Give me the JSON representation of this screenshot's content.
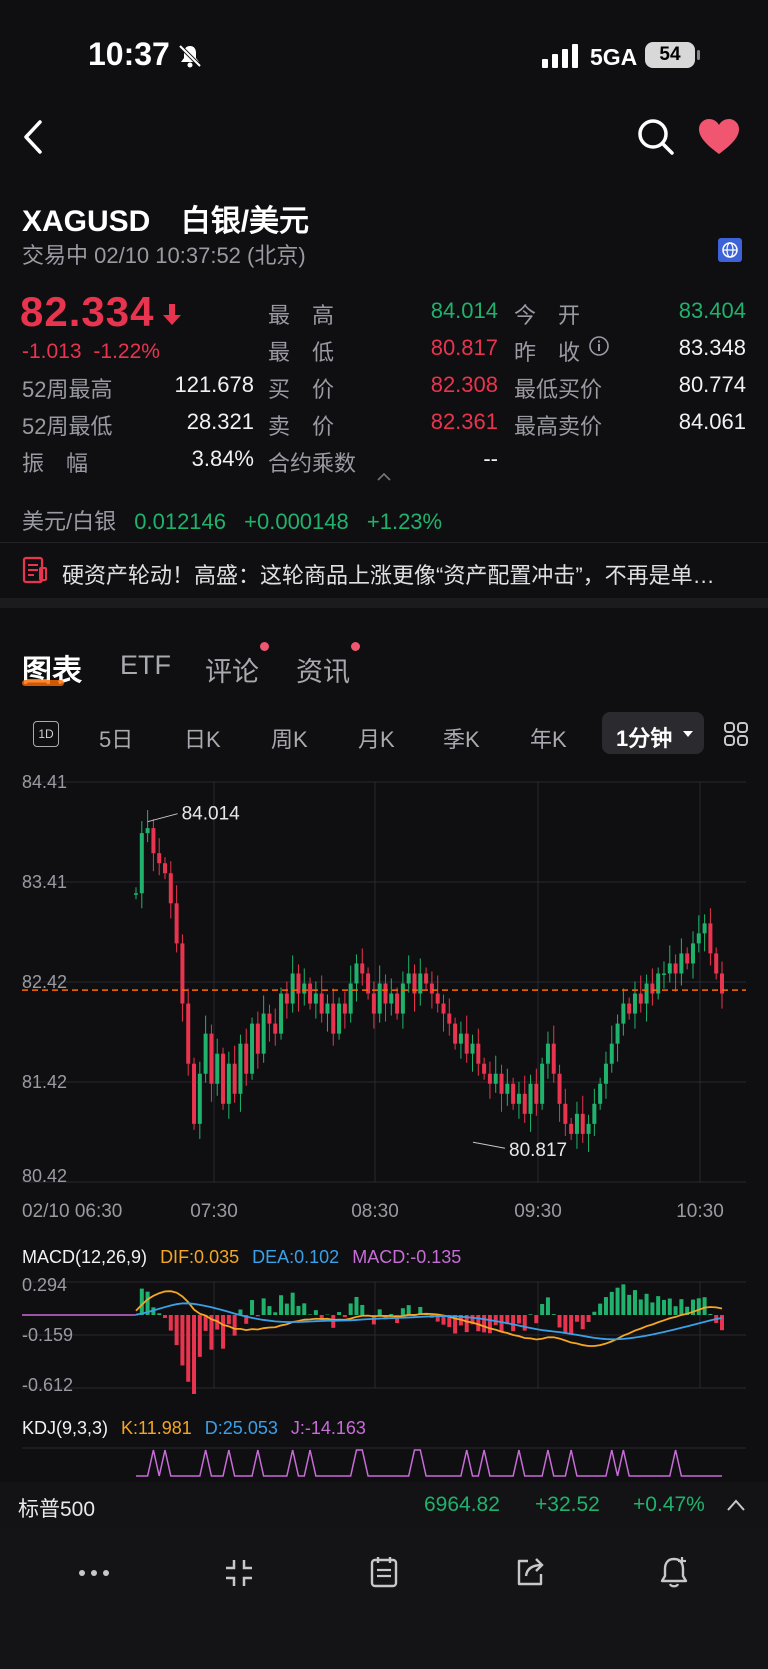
{
  "status_bar": {
    "time": "10:37",
    "network": "5GA",
    "battery": "54"
  },
  "header": {
    "symbol": "XAGUSD",
    "name": "白银/美元",
    "status_line": "交易中 02/10 10:37:52 (北京)"
  },
  "quote": {
    "price": "82.334",
    "change": "-1.013",
    "change_pct": "-1.22%",
    "rows": [
      {
        "l1": "最　高",
        "v1": "84.014",
        "c1": "green",
        "l2": "今　开",
        "v2": "83.404",
        "c2": "green"
      },
      {
        "l1": "最　低",
        "v1": "80.817",
        "c1": "red",
        "l2": "昨　收",
        "v2": "83.348",
        "c2": "white"
      },
      {
        "l1": "买　价",
        "v1": "82.308",
        "c1": "red",
        "l2": "最低买价",
        "v2": "80.774",
        "c2": "white"
      },
      {
        "l1": "卖　价",
        "v1": "82.361",
        "c1": "red",
        "l2": "最高卖价",
        "v2": "84.061",
        "c2": "white"
      },
      {
        "l1": "合约乘数",
        "v1": "--",
        "c1": "white",
        "l2": "",
        "v2": "",
        "c2": "white"
      }
    ],
    "left_rows": [
      {
        "label": "",
        "value": ""
      },
      {
        "label": "",
        "value": ""
      },
      {
        "label": "52周最高",
        "value": "121.678"
      },
      {
        "label": "52周最低",
        "value": "28.321"
      },
      {
        "label": "振　幅",
        "value": "3.84%"
      }
    ]
  },
  "cross": {
    "label": "美元/白银",
    "value": "0.012146",
    "change": "+0.000148",
    "pct": "+1.23%"
  },
  "news": {
    "text": "硬资产轮动！高盛：这轮商品上涨更像“资产配置冲击”，不再是单…"
  },
  "tabs": [
    "图表",
    "ETF",
    "评论",
    "资讯"
  ],
  "ktabs": {
    "day_icon": "1D",
    "items": [
      "5日",
      "日K",
      "周K",
      "月K",
      "季K",
      "年K"
    ],
    "selected": "1分钟"
  },
  "chart_data": {
    "type": "candlestick",
    "y_ticks": [
      "84.41",
      "83.41",
      "82.42",
      "81.42",
      "80.42"
    ],
    "ylim": [
      80.42,
      84.41
    ],
    "x_ticks": [
      "02/10 06:30",
      "07:30",
      "08:30",
      "09:30",
      "10:30"
    ],
    "high_label": "84.014",
    "low_label": "80.817",
    "current_line": 82.334,
    "price_path": [
      83.3,
      83.9,
      83.95,
      83.7,
      83.6,
      83.5,
      83.2,
      82.8,
      82.2,
      81.6,
      81.0,
      81.5,
      81.9,
      81.4,
      81.7,
      81.2,
      81.6,
      81.3,
      81.8,
      81.5,
      82.0,
      81.7,
      82.1,
      82.0,
      81.9,
      82.3,
      82.2,
      82.5,
      82.3,
      82.4,
      82.2,
      82.3,
      82.1,
      82.2,
      81.9,
      82.2,
      82.1,
      82.4,
      82.6,
      82.5,
      82.3,
      82.1,
      82.4,
      82.2,
      82.3,
      82.1,
      82.4,
      82.5,
      82.3,
      82.5,
      82.4,
      82.3,
      82.2,
      82.1,
      82.0,
      81.8,
      81.9,
      81.7,
      81.8,
      81.6,
      81.5,
      81.4,
      81.5,
      81.3,
      81.4,
      81.2,
      81.3,
      81.1,
      81.4,
      81.2,
      81.6,
      81.8,
      81.5,
      81.2,
      81.0,
      80.9,
      81.1,
      80.9,
      81.0,
      81.2,
      81.4,
      81.6,
      81.8,
      82.0,
      82.2,
      82.1,
      82.3,
      82.2,
      82.4,
      82.3,
      82.5,
      82.5,
      82.6,
      82.5,
      82.7,
      82.6,
      82.8,
      82.9,
      83.0,
      82.7,
      82.5,
      82.3
    ],
    "macd": {
      "label": "MACD(12,26,9)",
      "dif": "DIF:0.035",
      "dea": "DEA:0.102",
      "macd": "MACD:-0.135",
      "y_ticks": [
        "0.294",
        "-0.159",
        "-0.612"
      ]
    },
    "kdj": {
      "label": "KDJ(9,3,3)",
      "k": "K:11.981",
      "d": "D:25.053",
      "j": "J:-14.163"
    }
  },
  "ticker": {
    "name": "标普500",
    "price": "6964.82",
    "change": "+32.52",
    "pct": "+0.47%"
  },
  "colors": {
    "up": "#20b26c",
    "down": "#e8344e",
    "accent": "#ff6a00",
    "dif": "#f5a623",
    "dea": "#3aa0e8",
    "macd": "#c86cd8"
  }
}
